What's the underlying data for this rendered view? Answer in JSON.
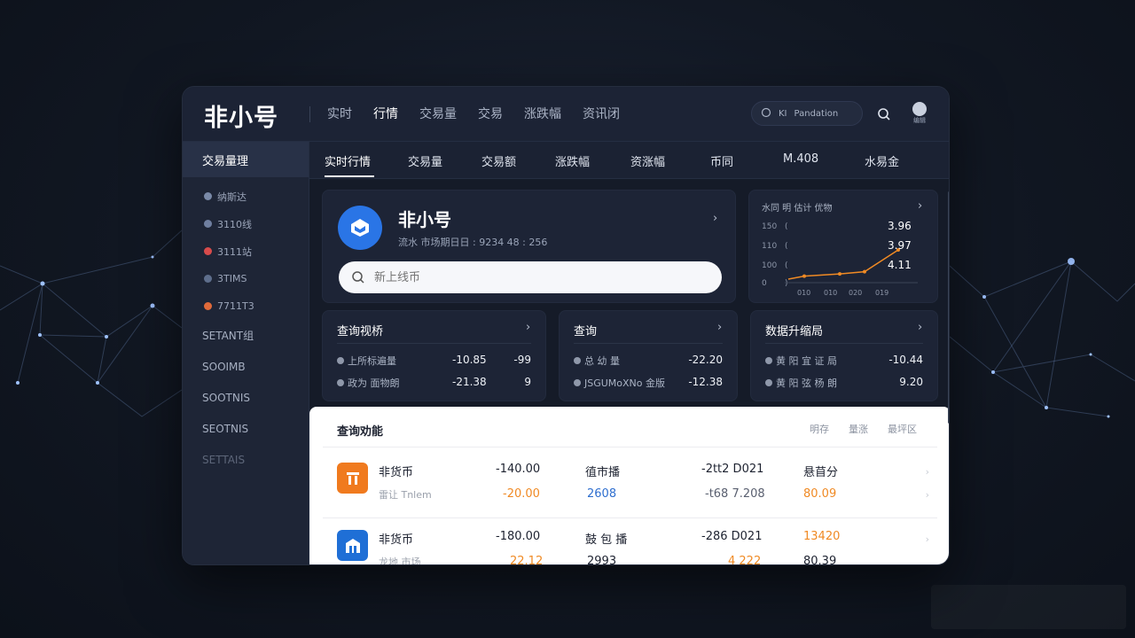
{
  "app": {
    "logo": "非小号",
    "nav": [
      "实时",
      "行情",
      "交易量",
      "交易",
      "涨跌幅",
      "资讯闭"
    ],
    "nav_active_index": 1,
    "top_search_text": "Pandation",
    "top_search_prefix": "KI",
    "avatar_label": "编辑"
  },
  "sidebar": {
    "header": "交易量理",
    "items": [
      {
        "label": "纳斯达",
        "color": "#7a8aa8"
      },
      {
        "label": "3110线",
        "color": "#6f7fa0"
      },
      {
        "label": "3111站",
        "color": "#d84b4b"
      },
      {
        "label": "3TIMS",
        "color": "#5e6e8c"
      },
      {
        "label": "7711T3",
        "color": "#e06a3a"
      }
    ],
    "groups": [
      "SETANT组",
      "SOOIMB",
      "SOOTNIS",
      "SEOTNIS",
      "SETTAIS"
    ]
  },
  "subtabs": [
    "实时行情",
    "交易量",
    "交易额",
    "涨跌幅",
    "资涨幅",
    "币同",
    "M.408",
    "水易金"
  ],
  "profile": {
    "name": "非小号",
    "subtitle": "流水 市场期日日 : 9234 48 :  256",
    "search_placeholder": "新上线币"
  },
  "mini_chart": {
    "title": "水同 明 估计 优物",
    "y_labels": [
      "150",
      "110",
      "100",
      "0"
    ],
    "x_labels": [
      "010",
      "010",
      "020",
      "019"
    ],
    "values": [
      "3.96",
      "3.97",
      "4.11"
    ],
    "accent": "#f08a24"
  },
  "chart_data": {
    "type": "line",
    "x": [
      "010",
      "010",
      "020",
      "019"
    ],
    "series": [
      {
        "values": [
          15,
          20,
          25,
          75
        ]
      }
    ],
    "ylim": [
      0,
      150
    ]
  },
  "cards": [
    {
      "title": "查询视桥",
      "rows": [
        {
          "label": "上所标遍量",
          "v1": "-10.85",
          "v2": "-99"
        },
        {
          "label": "政为 面物朗",
          "v1": "-21.38",
          "v2": "9"
        }
      ]
    },
    {
      "title": "查询",
      "rows": [
        {
          "label": "总 幼 量",
          "v1": "-22.20",
          "v2": ""
        },
        {
          "label": "JSGUMoXNo 金版",
          "v1": "-12.38",
          "v2": ""
        }
      ]
    },
    {
      "title": "数据升缩局",
      "rows": [
        {
          "label": "黄 阳 宜 证 局",
          "v1": "-10.44",
          "v2": ""
        },
        {
          "label": "黄 阳 弦 杨 朗",
          "v1": "9.20",
          "v2": ""
        }
      ]
    }
  ],
  "table": {
    "title": "查询劝能",
    "links": [
      "明存",
      "量涨",
      "最坪区"
    ],
    "rows": [
      {
        "name": "非货币",
        "sub": "雷让 Tnlem",
        "price": "-140.00",
        "change": "-20.00",
        "label2": "徝市播",
        "val2": "2608",
        "label3": "-2tt2 D021",
        "val3": "-t68 7.208",
        "label4": "悬苜分",
        "val4": "80.09",
        "icon_color": "#f07a1e"
      },
      {
        "name": "非货币",
        "sub": "龙地 市场",
        "price": "-180.00",
        "change": "22.12",
        "label2": "鼓 包 播",
        "val2": "2993",
        "label3": "-286 D021",
        "val3": "4 222",
        "label4": "13420",
        "val4": "80.39",
        "icon_color": "#1f6fd6"
      }
    ]
  }
}
